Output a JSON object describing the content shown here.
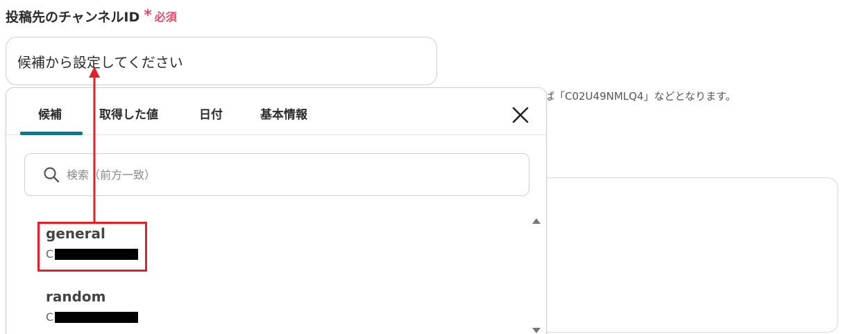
{
  "field": {
    "label": "投稿先のチャンネルID",
    "required_star": "*",
    "required_text": "必須",
    "input_placeholder": "候補から設定してください"
  },
  "helper_note": "ば「C02U49NMLQ4」などとなります。",
  "popup": {
    "tabs": [
      {
        "label": "候補",
        "active": true
      },
      {
        "label": "取得した値",
        "active": false
      },
      {
        "label": "日付",
        "active": false
      },
      {
        "label": "基本情報",
        "active": false
      }
    ],
    "search_placeholder": "検索（前方一致）",
    "items": [
      {
        "name": "general",
        "id_prefix": "C"
      },
      {
        "name": "random",
        "id_prefix": "C"
      }
    ]
  },
  "icons": {
    "close": "close-icon",
    "search": "search-icon",
    "scroll_up": "chevron-up-icon",
    "scroll_down": "chevron-down-icon"
  },
  "colors": {
    "accent": "#1b6f84",
    "required": "#e64a6a",
    "annotation": "#e0202a"
  }
}
